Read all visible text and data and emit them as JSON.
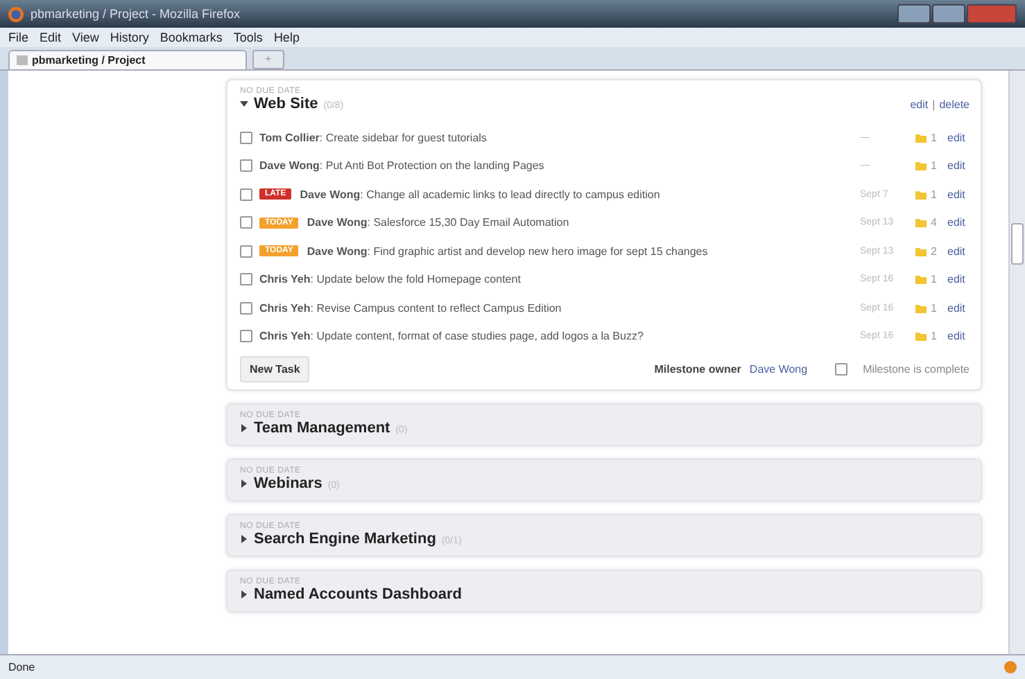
{
  "window": {
    "title": "pbmarketing / Project - Mozilla Firefox"
  },
  "menu": [
    "File",
    "Edit",
    "View",
    "History",
    "Bookmarks",
    "Tools",
    "Help"
  ],
  "tabs": [
    {
      "label": "pbmarketing / Project"
    }
  ],
  "new_tab": "+",
  "milestones": [
    {
      "due": "NO DUE DATE",
      "title": "Web Site",
      "count": "(0/8)",
      "expanded": true,
      "actions": [
        "edit",
        "delete"
      ],
      "actions_separator": "|",
      "tasks": [
        {
          "checked": false,
          "text": "**Tom Collier**: Create sidebar for guest tutorials",
          "date": "—",
          "files": "1",
          "edit": "edit"
        },
        {
          "checked": false,
          "text": "**Dave Wong**: Put Anti Bot Protection on the landing Pages",
          "date": "—",
          "files": "1",
          "edit": "edit"
        },
        {
          "checked": false,
          "badge": {
            "kind": "late",
            "label": "LATE"
          },
          "text": "**Dave Wong**: Change all academic links to lead directly to campus edition",
          "date": "Sept 7",
          "files": "1",
          "edit": "edit"
        },
        {
          "checked": false,
          "badge": {
            "kind": "today",
            "label": "TODAY"
          },
          "text": "**Dave Wong**: Salesforce 15,30 Day Email Automation",
          "date": "Sept 13",
          "files": "4",
          "edit": "edit"
        },
        {
          "checked": false,
          "badge": {
            "kind": "today",
            "label": "TODAY"
          },
          "text": "**Dave Wong**: Find graphic artist and develop new hero image for sept 15 changes",
          "date": "Sept 13",
          "files": "2",
          "edit": "edit"
        },
        {
          "checked": false,
          "text": "**Chris Yeh**: Update below the fold Homepage content",
          "date": "Sept 16",
          "files": "1",
          "edit": "edit"
        },
        {
          "checked": false,
          "text": "**Chris Yeh**: Revise Campus content to reflect Campus Edition",
          "date": "Sept 16",
          "files": "1",
          "edit": "edit"
        },
        {
          "checked": false,
          "text": "**Chris Yeh**: Update content, format of case studies page, add logos a la Buzz?",
          "date": "Sept 16",
          "files": "1",
          "edit": "edit"
        }
      ],
      "new_task": "New Task",
      "owner_label": "Milestone owner",
      "owner": "Dave Wong",
      "complete_label": "Milestone is complete",
      "complete": false
    },
    {
      "due": "NO DUE DATE",
      "title": "Team Management",
      "count": "(0)",
      "expanded": false
    },
    {
      "due": "NO DUE DATE",
      "title": "Webinars",
      "count": "(0)",
      "expanded": false
    },
    {
      "due": "NO DUE DATE",
      "title": "Search Engine Marketing",
      "count": "(0/1)",
      "expanded": false
    },
    {
      "due": "NO DUE DATE",
      "title": "Named Accounts Dashboard",
      "expanded": false
    }
  ],
  "status_bar": {
    "text": "Done"
  }
}
